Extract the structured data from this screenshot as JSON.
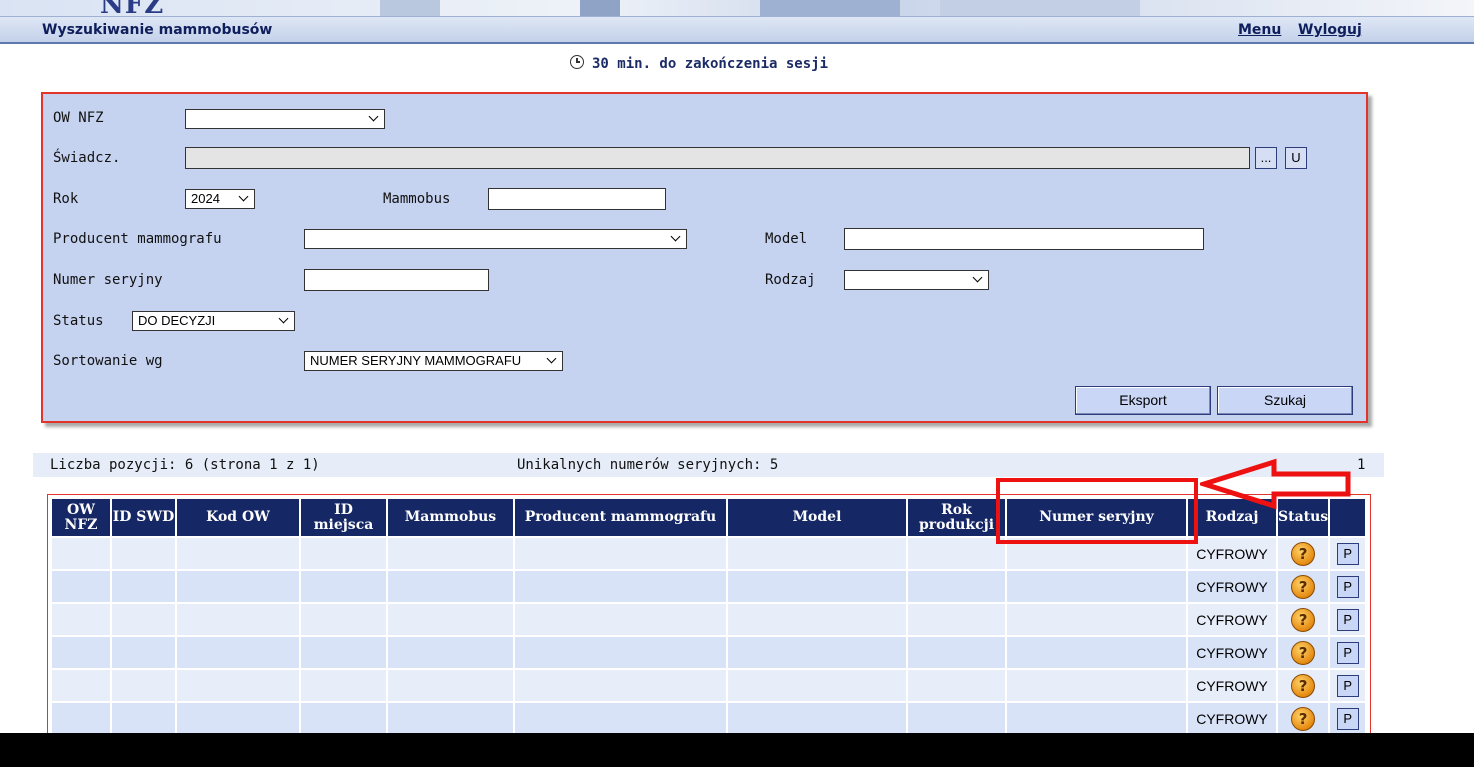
{
  "banner": {
    "logo": "NFZ"
  },
  "header": {
    "title": "Wyszukiwanie mammobusów",
    "menu_label": "Menu",
    "logout_label": "Wyloguj"
  },
  "session": {
    "text": "30 min. do zakończenia sesji"
  },
  "form": {
    "ow_nfz": {
      "label": "OW NFZ",
      "value": ""
    },
    "swiadcz": {
      "label": "Świadcz.",
      "value": "",
      "browse_label": "...",
      "clear_label": "U"
    },
    "rok": {
      "label": "Rok",
      "value": "2024"
    },
    "mammobus": {
      "label": "Mammobus",
      "value": ""
    },
    "producent": {
      "label": "Producent mammografu",
      "value": ""
    },
    "model": {
      "label": "Model",
      "value": ""
    },
    "numer": {
      "label": "Numer seryjny",
      "value": ""
    },
    "rodzaj": {
      "label": "Rodzaj",
      "value": ""
    },
    "status": {
      "label": "Status",
      "value": "DO DECYZJI"
    },
    "sort": {
      "label": "Sortowanie wg",
      "value": "NUMER SERYJNY MAMMOGRAFU"
    },
    "export_label": "Eksport",
    "search_label": "Szukaj"
  },
  "info": {
    "count": "Liczba pozycji: 6  (strona 1 z 1)",
    "unique": "Unikalnych numerów seryjnych: 5",
    "page": "1"
  },
  "table": {
    "headers": [
      "OW NFZ",
      "ID SWD",
      "Kod OW",
      "ID miejsca",
      "Mammobus",
      "Producent mammografu",
      "Model",
      "Rok produkcji",
      "Numer seryjny",
      "Rodzaj",
      "Status",
      ""
    ],
    "header_lines": {
      "ow1": "OW",
      "ow2": "NFZ",
      "id1": "ID",
      "id2": "miejsca",
      "rok1": "Rok",
      "rok2": "produkcji"
    },
    "rows": [
      {
        "rodzaj": "CYFROWY",
        "status_icon": "?",
        "action": "P"
      },
      {
        "rodzaj": "CYFROWY",
        "status_icon": "?",
        "action": "P"
      },
      {
        "rodzaj": "CYFROWY",
        "status_icon": "?",
        "action": "P"
      },
      {
        "rodzaj": "CYFROWY",
        "status_icon": "?",
        "action": "P"
      },
      {
        "rodzaj": "CYFROWY",
        "status_icon": "?",
        "action": "P"
      },
      {
        "rodzaj": "CYFROWY",
        "status_icon": "?",
        "action": "P"
      }
    ]
  },
  "colors": {
    "header_bg": "#152765",
    "form_bg": "#c6d3f0",
    "annotation": "#ee1111"
  }
}
